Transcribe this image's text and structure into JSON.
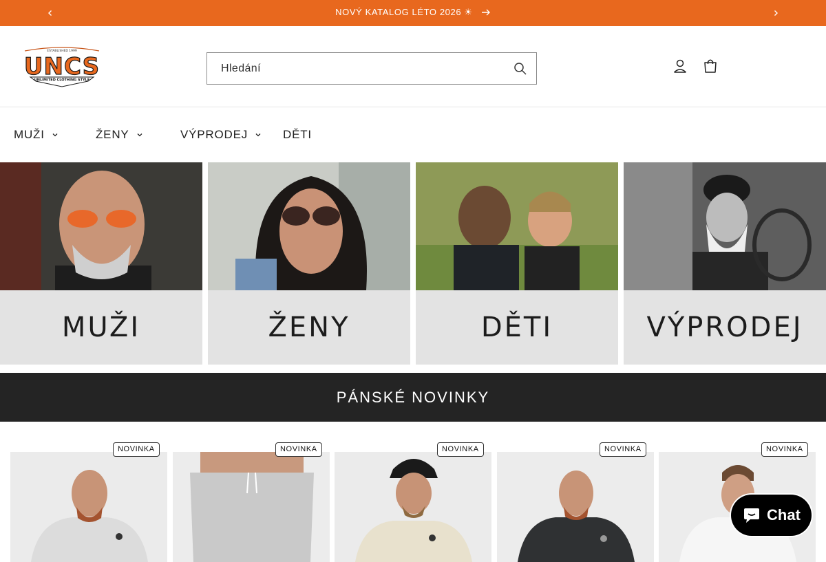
{
  "announcement": {
    "text": "NOVÝ KATALOG LÉTO 2026 ☀"
  },
  "header": {
    "logo_text": "UNCS",
    "logo_tagline": "UNLIMITED CLOTHING STYLE",
    "logo_established": "ESTABLISHED 1999",
    "search_placeholder": "Hledání"
  },
  "nav": {
    "items": [
      {
        "label": "MUŽI",
        "has_dropdown": true
      },
      {
        "label": "ŽENY",
        "has_dropdown": true
      },
      {
        "label": "VÝPRODEJ",
        "has_dropdown": true
      },
      {
        "label": "DĚTI",
        "has_dropdown": false
      }
    ]
  },
  "tiles": [
    {
      "label": "MUŽI"
    },
    {
      "label": "ŽENY"
    },
    {
      "label": "DĚTI"
    },
    {
      "label": "VÝPRODEJ"
    }
  ],
  "section": {
    "title": "PÁNSKÉ NOVINKY"
  },
  "products": [
    {
      "badge": "NOVINKA"
    },
    {
      "badge": "NOVINKA"
    },
    {
      "badge": "NOVINKA"
    },
    {
      "badge": "NOVINKA"
    },
    {
      "badge": "NOVINKA"
    }
  ],
  "chat": {
    "label": "Chat"
  },
  "colors": {
    "accent": "#e8681e",
    "dark_band": "#242424",
    "tile_band": "#e3e3e3"
  }
}
